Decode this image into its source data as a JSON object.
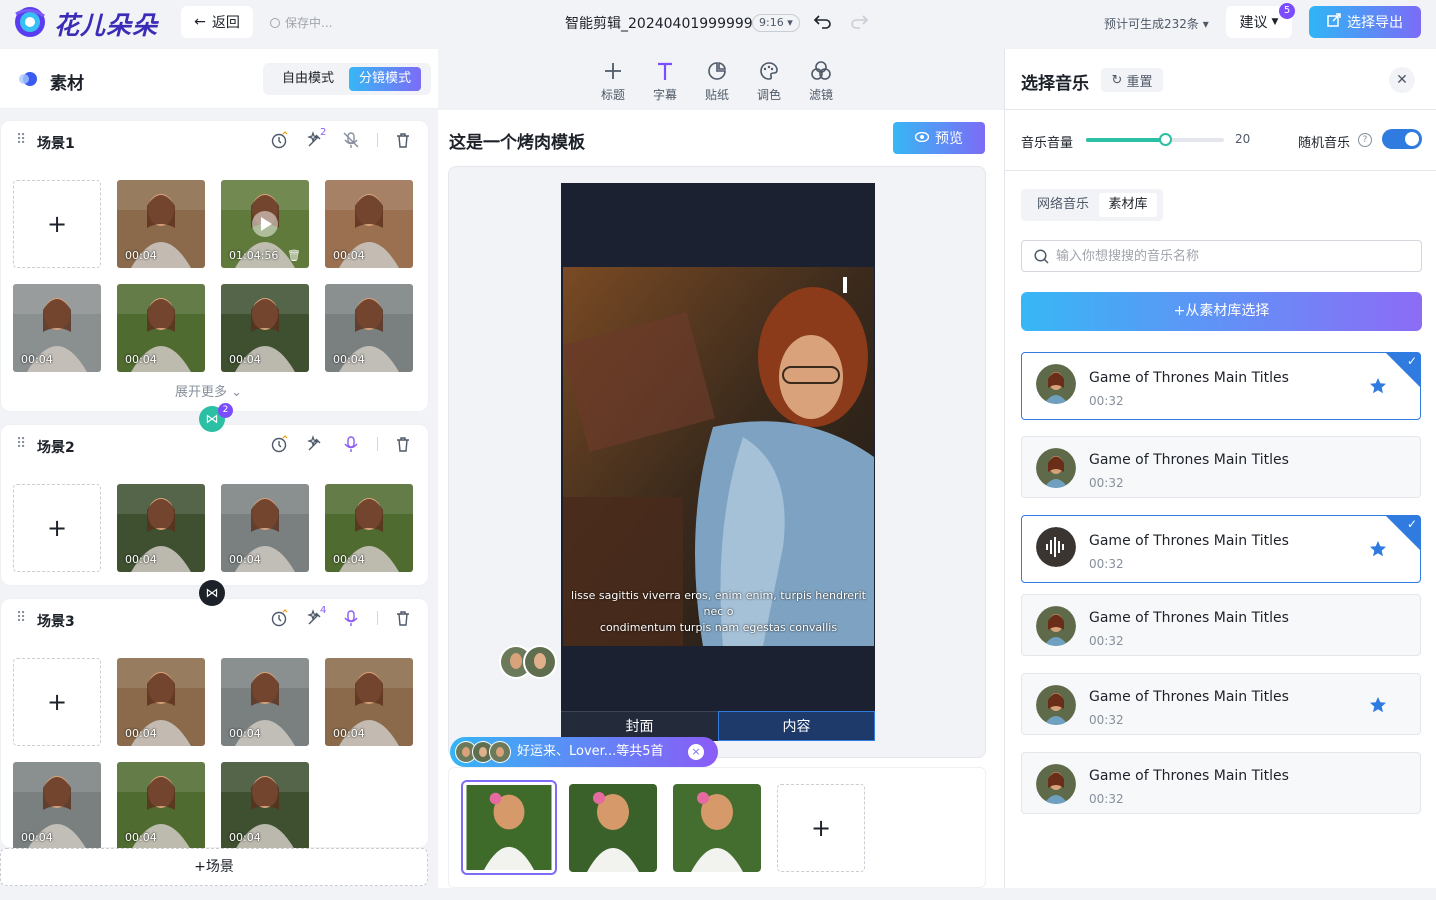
{
  "app": {
    "name": "花儿朵朵"
  },
  "topbar": {
    "back_label": "返回",
    "saving_text": "保存中...",
    "doc_title": "智能剪辑_20240401999999",
    "ratio": "9:16",
    "estimate": "预计可生成232条",
    "suggest_label": "建议",
    "suggest_badge": "5",
    "export_label": "选择导出"
  },
  "left": {
    "title": "素材",
    "modes": [
      "自由模式",
      "分镜模式"
    ],
    "active_mode": "分镜模式",
    "expand_more": "展开更多",
    "add_scene": "+场景",
    "add_symbol": "+",
    "scenes": [
      {
        "title": "场景1",
        "badge": "2",
        "durations": [
          "00:04",
          "01:04:56",
          "00:04",
          "00:04",
          "00:04",
          "00:04",
          "00:04"
        ]
      },
      {
        "title": "场景2",
        "badge": "",
        "durations": [
          "00:04",
          "00:04",
          "00:04"
        ]
      },
      {
        "title": "场景3",
        "badge": "4",
        "durations": [
          "00:04",
          "00:04",
          "00:04",
          "00:04",
          "00:04",
          "00:04"
        ]
      }
    ],
    "transition_badge": "2"
  },
  "toolbar": {
    "items": [
      {
        "label": "标题",
        "icon": "plus-icon"
      },
      {
        "label": "字幕",
        "icon": "text-icon"
      },
      {
        "label": "贴纸",
        "icon": "sticker-icon"
      },
      {
        "label": "调色",
        "icon": "palette-icon"
      },
      {
        "label": "滤镜",
        "icon": "filter-icon"
      }
    ]
  },
  "center": {
    "template_title": "这是一个烤肉模板",
    "preview_label": "预览",
    "subtitle_line1": "lisse sagittis viverra eros, enim enim, turpis hendrerit nec o",
    "subtitle_line2": "condimentum turpis nam egestas convallis",
    "tab_cover": "封面",
    "tab_content": "内容",
    "music_pill": "好运来、Lover...等共5首",
    "add_symbol": "+"
  },
  "right": {
    "title": "选择音乐",
    "reset_label": "重置",
    "volume_label": "音乐音量",
    "volume_value": "20",
    "volume_fraction": 0.57,
    "random_label": "随机音乐",
    "random_on": true,
    "tabs": [
      "网络音乐",
      "素材库"
    ],
    "active_tab": "素材库",
    "search_placeholder": "输入你想搜搜的音乐名称",
    "from_library": "+从素材库选择",
    "tracks": [
      {
        "name": "Game of Thrones Main Titles",
        "duration": "00:32",
        "selected": true,
        "starred": true,
        "playing": false
      },
      {
        "name": "Game of Thrones Main Titles",
        "duration": "00:32",
        "selected": false,
        "starred": false,
        "playing": false
      },
      {
        "name": "Game of Thrones Main Titles",
        "duration": "00:32",
        "selected": true,
        "starred": true,
        "playing": true
      },
      {
        "name": "Game of Thrones Main Titles",
        "duration": "00:32",
        "selected": false,
        "starred": false,
        "playing": false
      },
      {
        "name": "Game of Thrones Main Titles",
        "duration": "00:32",
        "selected": false,
        "starred": true,
        "playing": false
      },
      {
        "name": "Game of Thrones Main Titles",
        "duration": "00:32",
        "selected": false,
        "starred": false,
        "playing": false
      }
    ]
  },
  "colors": {
    "accent": "#2f7be0",
    "brand_gradient_start": "#37b7f5",
    "brand_gradient_end": "#7c6cf6",
    "slider": "#2bbfa4"
  }
}
